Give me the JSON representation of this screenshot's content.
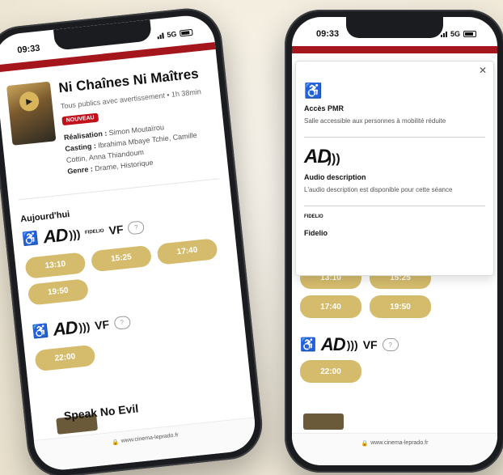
{
  "status": {
    "time": "09:33",
    "network": "5G"
  },
  "film": {
    "title": "Ni Chaînes Ni Maîtres",
    "audience": "Tous publics avec avertissement",
    "duration": "1h 38min",
    "badge": "NOUVEAU",
    "credits": [
      {
        "label": "Réalisation :",
        "value": "Simon Moutaïrou"
      },
      {
        "label": "Casting :",
        "value": "Ibrahima Mbaye Tchie, Camille Cottin, Anna Thiandoum"
      },
      {
        "label": "Genre :",
        "value": "Drame, Historique"
      }
    ]
  },
  "showtimes": {
    "day_label": "Aujourd'hui",
    "group1": {
      "labels": {
        "ad": "AD",
        "fid": "FIDELIO",
        "vf": "VF"
      },
      "times": [
        "13:10",
        "15:25",
        "17:40",
        "19:50"
      ]
    },
    "group2": {
      "labels": {
        "ad": "AD",
        "vf": "VF"
      },
      "times": [
        "22:00"
      ]
    }
  },
  "next_film_title": "Speak No Evil",
  "url": "www.cinema-leprado.fr",
  "modal": {
    "items": [
      {
        "title": "Accès PMR",
        "desc": "Salle accessible aux personnes à mobilité réduite"
      },
      {
        "icon_text": "AD",
        "title": "Audio description",
        "desc": "L'audio description est disponible pour cette séance"
      },
      {
        "icon_text": "FIDELIO",
        "title": "Fidelio"
      }
    ]
  },
  "colors": {
    "accent_red": "#a5151c",
    "pill_gold": "#d5bc6d"
  }
}
